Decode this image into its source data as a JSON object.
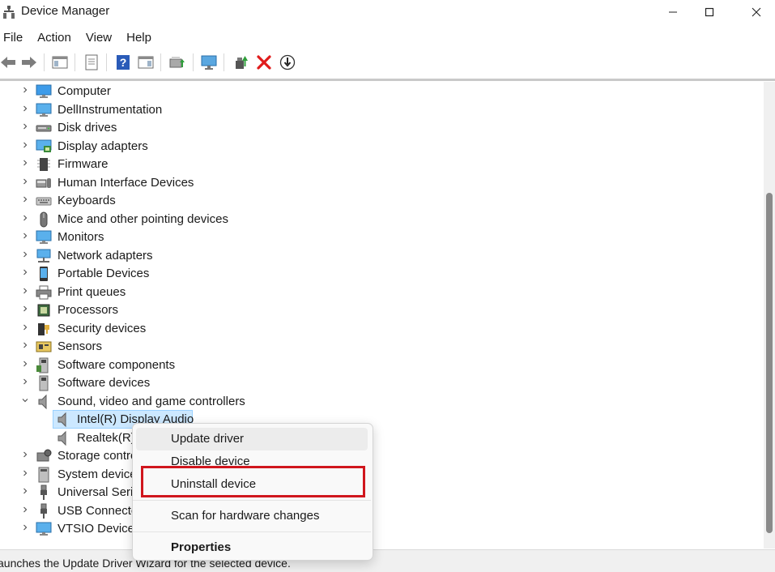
{
  "window": {
    "title": "Device Manager",
    "app_icon": "device-manager-icon",
    "controls": [
      "minimize-icon",
      "maximize-icon",
      "close-icon"
    ]
  },
  "menu": [
    "File",
    "Action",
    "View",
    "Help"
  ],
  "toolbar": [
    "back-icon",
    "forward-icon",
    "console-tree-icon",
    "properties-icon",
    "help-icon",
    "action-pane-icon",
    "update-driver-icon",
    "scan-hardware-icon",
    "enable-device-icon",
    "uninstall-device-icon",
    "disable-device-icon"
  ],
  "tree": [
    {
      "label": "Computer",
      "icon": "computer-icon",
      "expanded": false
    },
    {
      "label": "DellInstrumentation",
      "icon": "monitor-icon",
      "expanded": false
    },
    {
      "label": "Disk drives",
      "icon": "disk-drive-icon",
      "expanded": false
    },
    {
      "label": "Display adapters",
      "icon": "display-adapter-icon",
      "expanded": false
    },
    {
      "label": "Firmware",
      "icon": "firmware-icon",
      "expanded": false
    },
    {
      "label": "Human Interface Devices",
      "icon": "hid-icon",
      "expanded": false
    },
    {
      "label": "Keyboards",
      "icon": "keyboard-icon",
      "expanded": false
    },
    {
      "label": "Mice and other pointing devices",
      "icon": "mouse-icon",
      "expanded": false
    },
    {
      "label": "Monitors",
      "icon": "monitor-icon",
      "expanded": false
    },
    {
      "label": "Network adapters",
      "icon": "network-adapter-icon",
      "expanded": false
    },
    {
      "label": "Portable Devices",
      "icon": "portable-device-icon",
      "expanded": false
    },
    {
      "label": "Print queues",
      "icon": "printer-icon",
      "expanded": false
    },
    {
      "label": "Processors",
      "icon": "processor-icon",
      "expanded": false
    },
    {
      "label": "Security devices",
      "icon": "security-device-icon",
      "expanded": false
    },
    {
      "label": "Sensors",
      "icon": "sensor-icon",
      "expanded": false
    },
    {
      "label": "Software components",
      "icon": "software-component-icon",
      "expanded": false
    },
    {
      "label": "Software devices",
      "icon": "software-device-icon",
      "expanded": false
    },
    {
      "label": "Sound, video and game controllers",
      "icon": "speaker-icon",
      "expanded": true,
      "children": [
        {
          "label": "Intel(R) Display Audio",
          "icon": "speaker-icon",
          "selected": true
        },
        {
          "label": "Realtek(R)",
          "icon": "speaker-icon",
          "selected": false
        }
      ]
    },
    {
      "label": "Storage contro",
      "icon": "storage-controller-icon",
      "expanded": false
    },
    {
      "label": "System device",
      "icon": "system-device-icon",
      "expanded": false
    },
    {
      "label": "Universal Seria",
      "icon": "usb-icon",
      "expanded": false
    },
    {
      "label": "USB Connecto",
      "icon": "usb-icon",
      "expanded": false
    },
    {
      "label": "VTSIO Devices",
      "icon": "monitor-icon",
      "expanded": false
    }
  ],
  "context_menu": {
    "items": [
      "Update driver",
      "Disable device",
      "Uninstall device",
      "Scan for hardware changes",
      "Properties"
    ],
    "hovered": "Update driver",
    "highlighted": "Uninstall device",
    "highlight_color": "#d0161d"
  },
  "status": "aunches the Update Driver Wizard for the selected device.",
  "colors": {
    "selection": "#cce8ff",
    "selection_border": "#99d1ff",
    "accent_blue": "#1e88e5"
  }
}
